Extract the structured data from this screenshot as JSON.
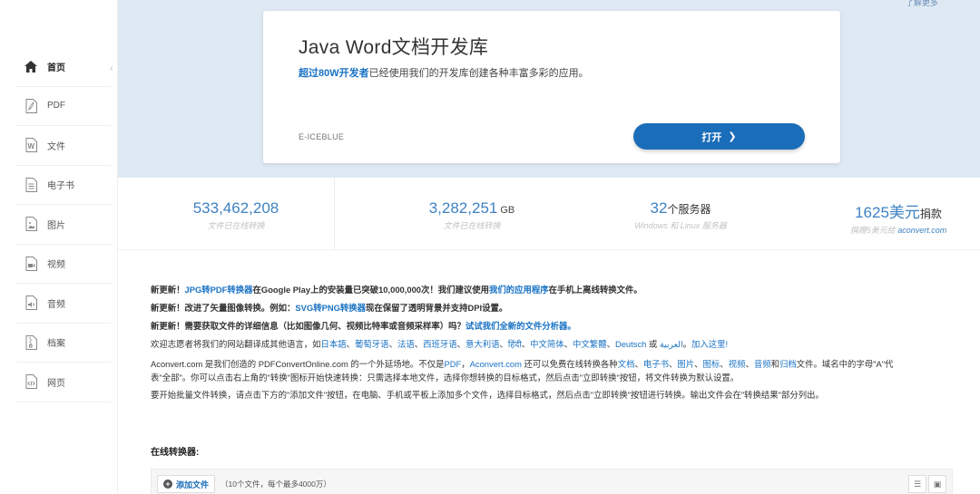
{
  "sidebar": {
    "items": [
      {
        "label": "首页",
        "icon": "home-icon"
      },
      {
        "label": "PDF",
        "icon": "pdf-file-icon"
      },
      {
        "label": "文件",
        "icon": "word-file-icon"
      },
      {
        "label": "电子书",
        "icon": "ebook-icon"
      },
      {
        "label": "图片",
        "icon": "image-file-icon"
      },
      {
        "label": "视频",
        "icon": "video-file-icon"
      },
      {
        "label": "音频",
        "icon": "audio-file-icon"
      },
      {
        "label": "档案",
        "icon": "archive-file-icon"
      },
      {
        "label": "网页",
        "icon": "webpage-file-icon"
      }
    ]
  },
  "hero": {
    "top_link": "了解更多",
    "title": "Java Word文档开发库",
    "sub_highlight": "超过80W开发者",
    "sub_rest": "已经使用我们的开发库创建各种丰富多彩的应用。",
    "brand": "E-ICEBLUE",
    "button_label": "打开"
  },
  "stats": [
    {
      "num": "533,462,208",
      "unit": "",
      "caption": "文件已在线转换"
    },
    {
      "num": "3,282,251",
      "unit": "GB",
      "caption": "文件已在线转换"
    },
    {
      "num": "32",
      "unit_text": "个服务器",
      "caption": "Windows 和 Linux 服务器"
    },
    {
      "num": "1625美元",
      "unit_text": "捐款",
      "caption_pre": "捐赠5美元给 ",
      "caption_link": "aconvert.com"
    }
  ],
  "news": {
    "l1_a": "新更新！",
    "l1_link": "JPG转PDF转换器",
    "l1_b": "在Google Play上的安装量已突破10,000,000次！我们建议使用",
    "l1_link2": "我们的应用程序",
    "l1_c": "在手机上离线转换文件。",
    "l2_a": "新更新！改进了矢量图像转换。例如：",
    "l2_link": "SVG转PNG转换器",
    "l2_b": "现在保留了透明背景并支持DPI设置。",
    "l3_a": "新更新！需要获取文件的详细信息（比如图像几何、视频比特率或音频采样率）吗？",
    "l3_link": "试试我们全新的文件分析器。",
    "l4_a": "欢迎志愿者将我们的网站翻译成其他语言，如",
    "l4_langs": [
      "日本語",
      "葡萄牙语",
      "法语",
      "西班牙语",
      "意大利语",
      "हिंदी",
      "中文简体",
      "中文繁體",
      "Deutsch"
    ],
    "l4_or": "或",
    "l4_arabic": "العربية",
    "l4_join": "加入这里!",
    "p1_a": "Aconvert.com 是我们创造的 PDFConvertOnline.com 的一个外延场地。不仅是",
    "p1_links": [
      "PDF",
      "Aconvert.com"
    ],
    "p1_b": " 还可以免费在线转换各种",
    "p1_types": [
      "文档",
      "电子书",
      "图片",
      "图标",
      "视频",
      "音频",
      "归档"
    ],
    "p1_c": "文件。域名中的字母\"A\"代",
    "p1_d": "表\"全部\"。你可以点击右上角的\"转换\"图标开始快速转换：只需选择本地文件，选择你想转换的目标格式，然后点击\"立即转换\"按钮，将文件转换为默认设置。",
    "p2": "要开始批量文件转换，请点击下方的\"添加文件\"按钮，在电脑、手机或平板上添加多个文件，选择目标格式，然后点击\"立即转换\"按钮进行转换。输出文件会在\"转换结果\"部分列出。"
  },
  "online": {
    "title": "在线转换器:",
    "add_label": "添加文件",
    "note": "（10个文件，每个最多4000万）"
  }
}
